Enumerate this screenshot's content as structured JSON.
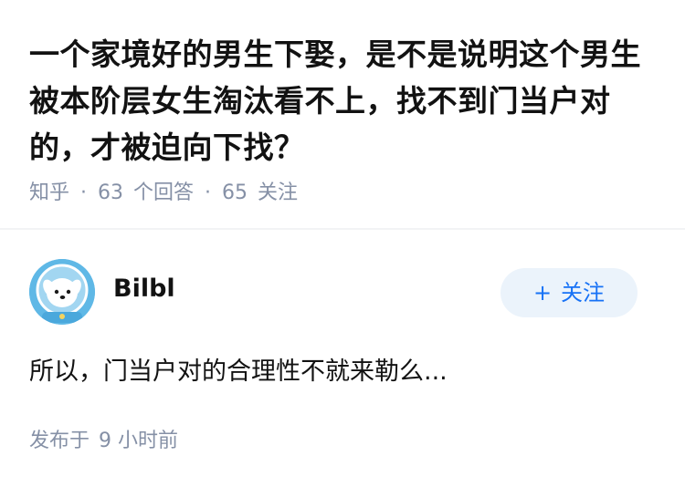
{
  "question": {
    "title": "一个家境好的男生下娶，是不是说明这个男生被本阶层女生淘汰看不上，找不到门当户对的，才被迫向下找？",
    "source": "知乎",
    "separator": "·",
    "answers_count": "63",
    "answers_label": "个回答",
    "followers_count": "65",
    "followers_label": "关注"
  },
  "answer": {
    "author_name": "Bilbl",
    "follow_plus": "+",
    "follow_label": "关注",
    "content": "所以，门当户对的合理性不就来勒么...",
    "published_label": "发布于",
    "published_time": "9 小时前"
  },
  "icons": {
    "avatar": "avatar-dog-astronaut-icon"
  },
  "colors": {
    "title_text": "#121212",
    "meta_text": "#8590a6",
    "follow_button_bg": "#ebf3fb",
    "follow_button_text": "#1772f6",
    "avatar_bg": "#5fb8e6",
    "divider": "#f2f3f5"
  }
}
